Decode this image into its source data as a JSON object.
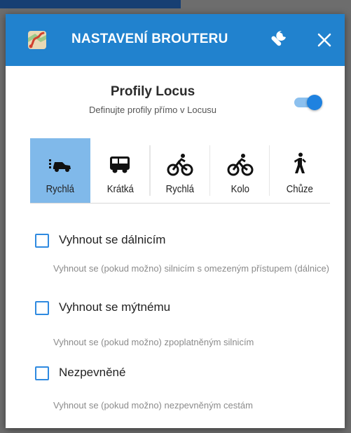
{
  "header": {
    "title": "NASTAVENÍ BROUTERU",
    "app_icon": "map-route-icon",
    "settings_icon": "wrench-icon",
    "close_icon": "close-icon",
    "color": "#2182ce"
  },
  "profiles": {
    "title": "Profily Locus",
    "subtitle": "Definujte profily přímo v Locusu",
    "toggle_on": true
  },
  "modes": [
    {
      "label": "Rychlá",
      "icon": "car-fast-icon",
      "selected": true
    },
    {
      "label": "Krátká",
      "icon": "bus-icon",
      "selected": false
    },
    {
      "label": "Rychlá",
      "icon": "bike-icon",
      "selected": false
    },
    {
      "label": "Kolo",
      "icon": "bike-icon",
      "selected": false
    },
    {
      "label": "Chůze",
      "icon": "hiking-icon",
      "selected": false
    }
  ],
  "options": [
    {
      "label": "Vyhnout se dálnicím",
      "description": "Vyhnout se (pokud možno) silnicím s omezeným přístupem (dálnice)",
      "checked": false
    },
    {
      "label": "Vyhnout se mýtnému",
      "description": "Vyhnout se (pokud možno) zpoplatněným silnicím",
      "checked": false
    },
    {
      "label": "Nezpevněné",
      "description": "Vyhnout se (pokud možno) nezpevněným cestám",
      "checked": false
    }
  ],
  "colors": {
    "accent": "#2182ce",
    "selected_tab": "#80b9ea",
    "toggle": "#1f82e0"
  }
}
